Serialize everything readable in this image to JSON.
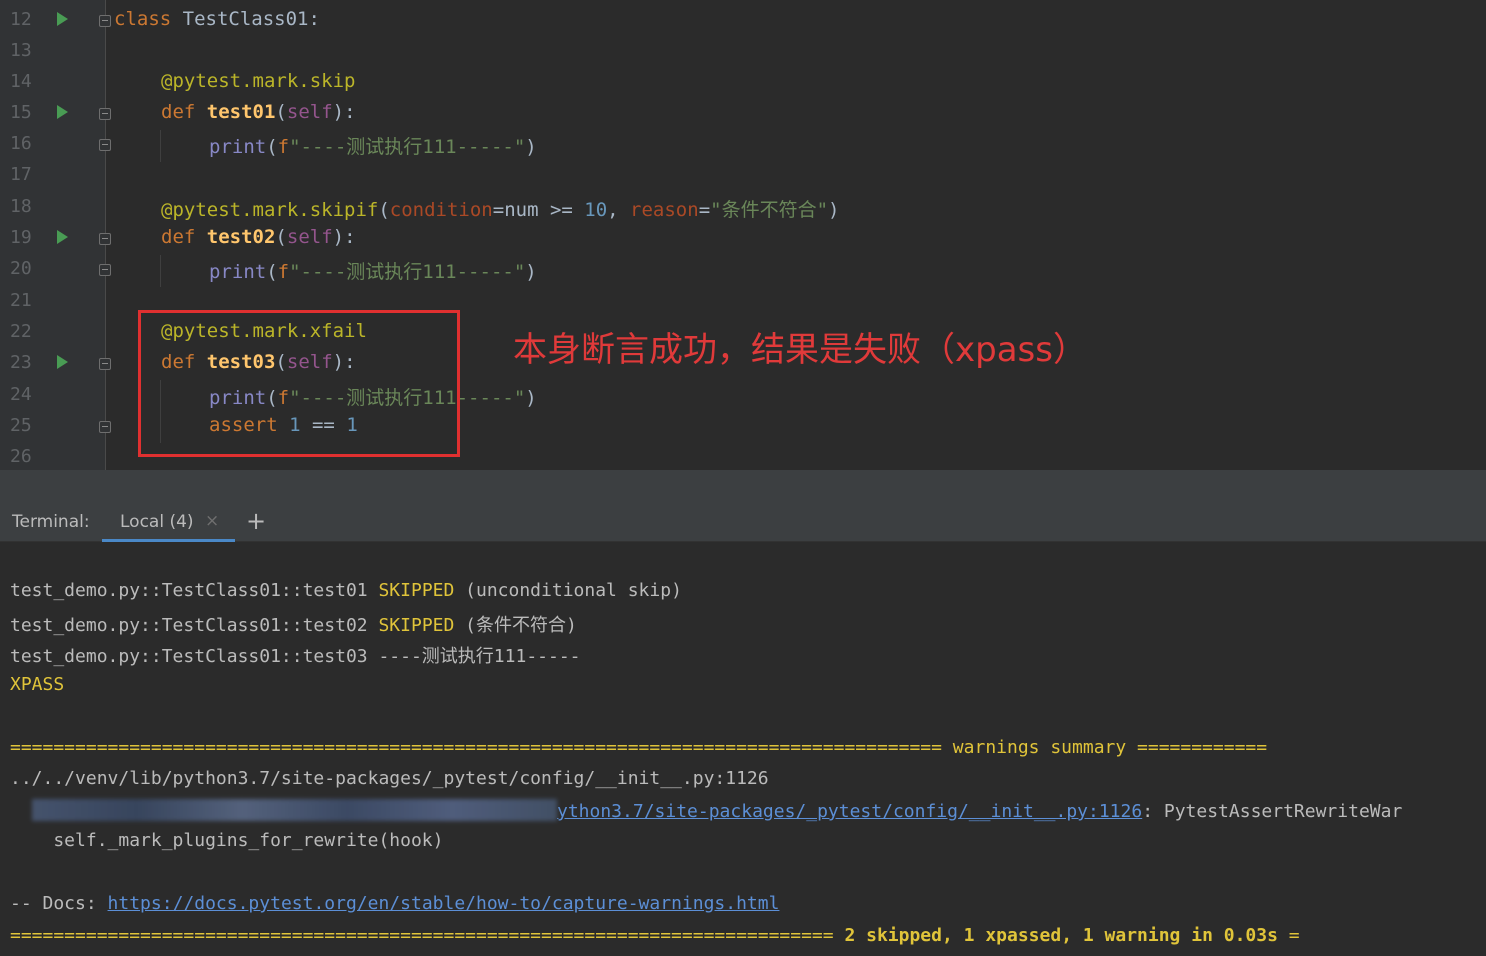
{
  "editor": {
    "lines": [
      {
        "n": "12",
        "run": true,
        "fold": true
      },
      {
        "n": "13"
      },
      {
        "n": "14"
      },
      {
        "n": "15",
        "run": true,
        "fold": true
      },
      {
        "n": "16",
        "fold": true
      },
      {
        "n": "17"
      },
      {
        "n": "18"
      },
      {
        "n": "19",
        "run": true,
        "fold": true
      },
      {
        "n": "20",
        "fold": true
      },
      {
        "n": "21"
      },
      {
        "n": "22"
      },
      {
        "n": "23",
        "run": true,
        "fold": true
      },
      {
        "n": "24"
      },
      {
        "n": "25",
        "fold": true
      },
      {
        "n": "26"
      }
    ],
    "code": {
      "l12": {
        "kw": "class",
        "name": " TestClass01:"
      },
      "l14": {
        "deco": "@pytest.mark.skip"
      },
      "l15": {
        "kw": "def",
        "fn": "test01",
        "open": "(",
        "self": "self",
        "close": "):"
      },
      "l16": {
        "bi": "print",
        "open": "(",
        "f": "f",
        "str": "\"----测试执行111-----\"",
        "close": ")"
      },
      "l18": {
        "deco": "@pytest.mark.skipif",
        "open": "(",
        "p1": "condition",
        "mid1": "=num >= ",
        "n1": "10",
        "comma": ", ",
        "p2": "reason",
        "eq": "=",
        "str": "\"条件不符合\"",
        "close": ")"
      },
      "l19": {
        "kw": "def",
        "fn": "test02",
        "open": "(",
        "self": "self",
        "close": "):"
      },
      "l20": {
        "bi": "print",
        "open": "(",
        "f": "f",
        "str": "\"----测试执行111-----\"",
        "close": ")"
      },
      "l22": {
        "deco": "@pytest.mark.xfail"
      },
      "l23": {
        "kw": "def",
        "fn": "test03",
        "open": "(",
        "self": "self",
        "close": "):"
      },
      "l24": {
        "bi": "print",
        "open": "(",
        "f": "f",
        "str": "\"----测试执行111-----\"",
        "close": ")"
      },
      "l25": {
        "kw": "assert",
        "n1": "1",
        "op": " == ",
        "n2": "1"
      }
    },
    "annotation": "本身断言成功，结果是失败（xpass）"
  },
  "terminal": {
    "label": "Terminal:",
    "tab": "Local (4)",
    "tab_close": "×",
    "add": "+",
    "lines": {
      "r1_prefix": "test_demo.py::TestClass01::test01 ",
      "r1_status": "SKIPPED",
      "r1_rest": " (unconditional skip)",
      "r2_prefix": "test_demo.py::TestClass01::test02 ",
      "r2_status": "SKIPPED",
      "r2_rest": " (条件不符合)",
      "r3": "test_demo.py::TestClass01::test03 ----测试执行111-----",
      "r4": "XPASS",
      "w_sep": "====================================================================================== warnings summary ============",
      "w_path": "../../venv/lib/python3.7/site-packages/_pytest/config/__init__.py:1126",
      "w_link": "ython3.7/site-packages/_pytest/config/__init__.py:1126",
      "w_rest": ": PytestAssertRewriteWar",
      "w_hook": "    self._mark_plugins_for_rewrite(hook)",
      "docs_prefix": "-- Docs: ",
      "docs_link": "https://docs.pytest.org/en/stable/how-to/capture-warnings.html",
      "summary_sep": "============================================================================ ",
      "summary": "2 skipped, 1 xpassed, 1 warning in 0.03s",
      "summary_end": " ="
    }
  }
}
